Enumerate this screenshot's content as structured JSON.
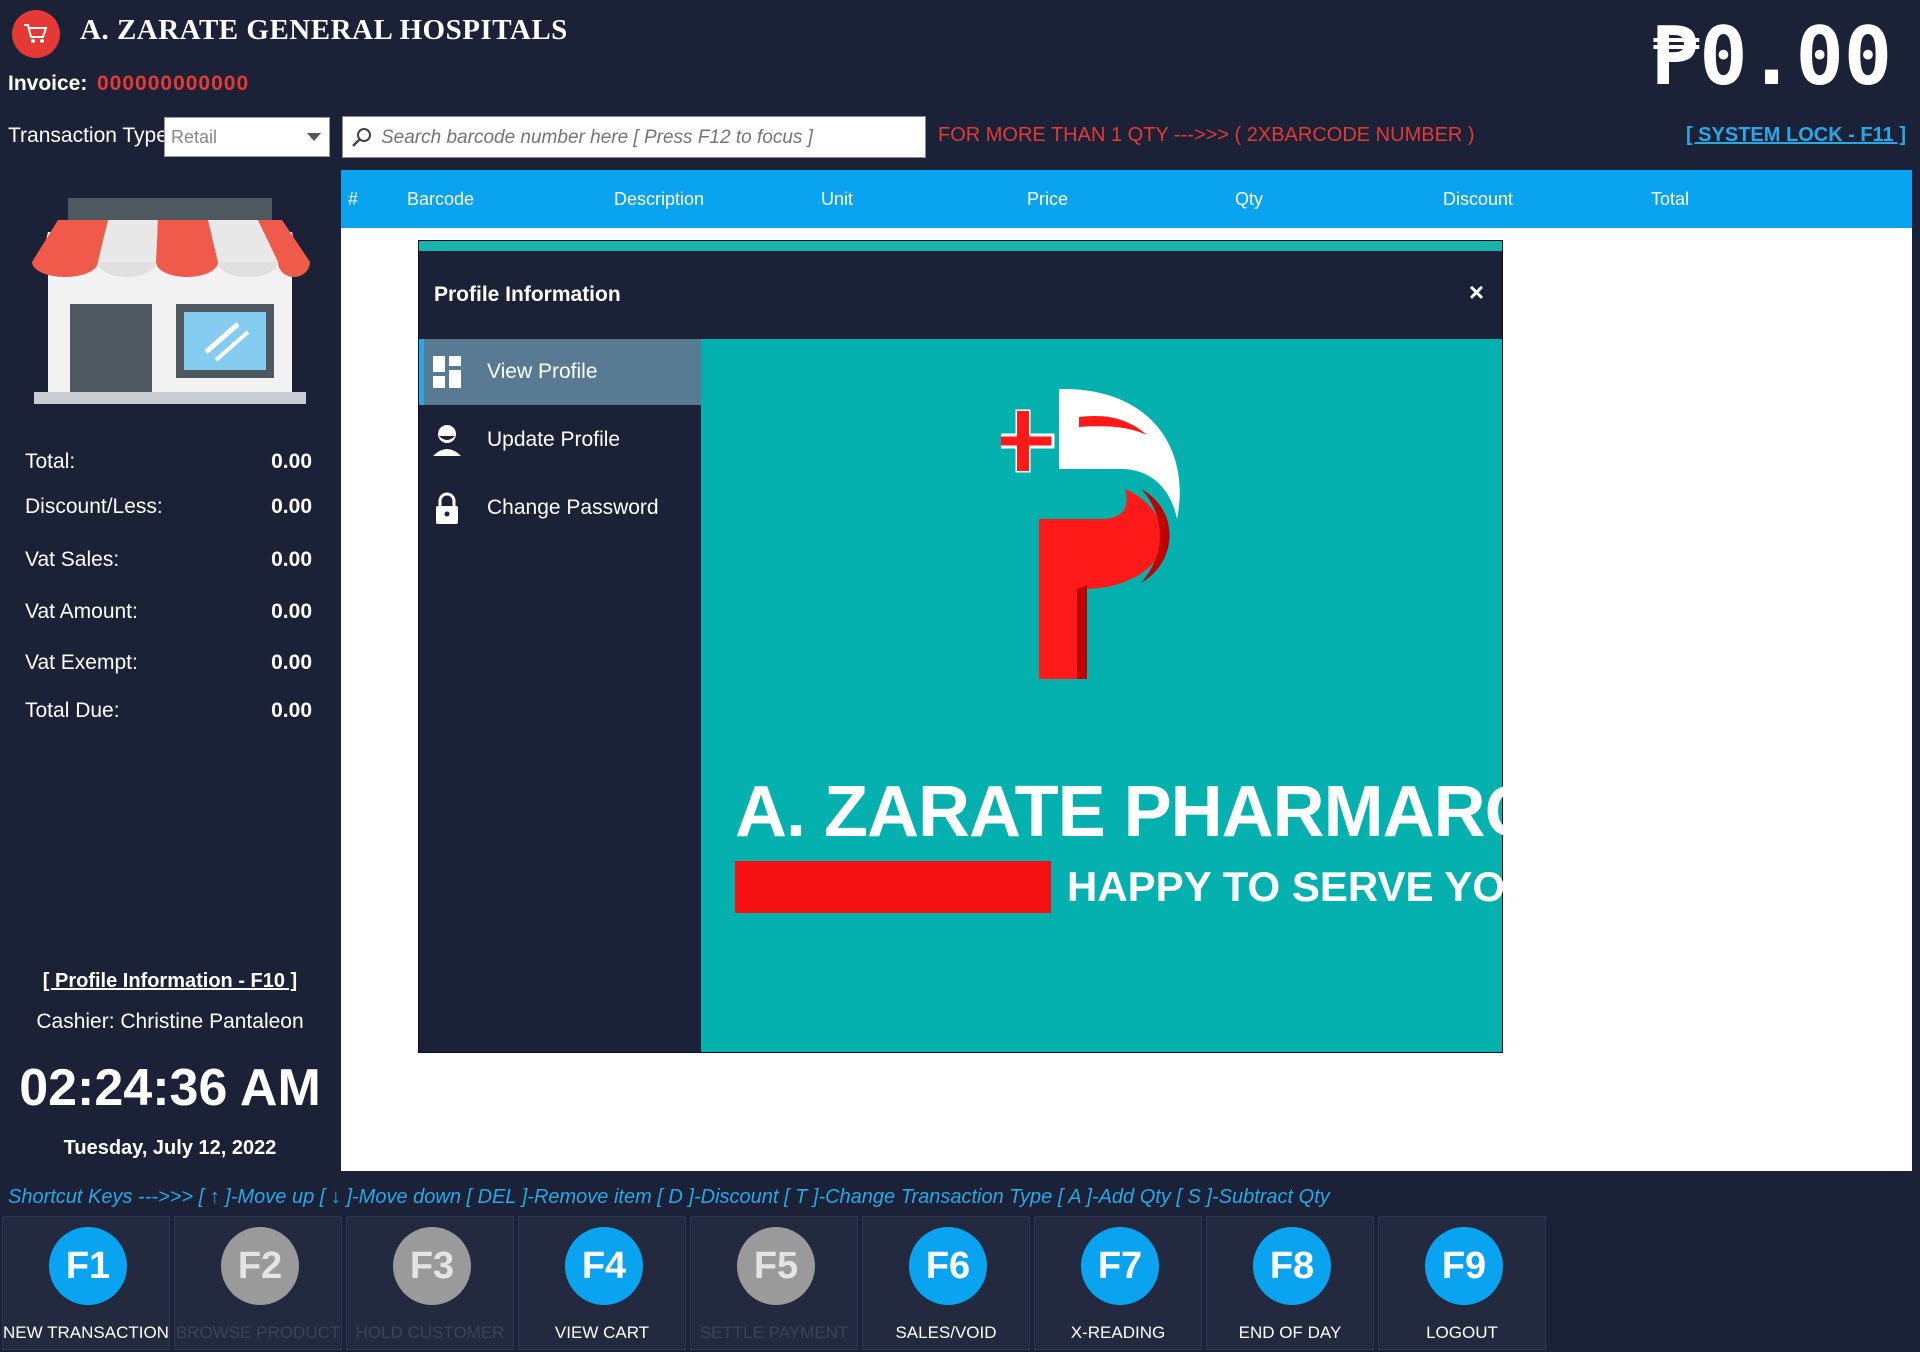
{
  "header": {
    "title": "A. ZARATE GENERAL HOSPITALS",
    "invoice_label": "Invoice:",
    "invoice_number": "000000000000",
    "total_amount": "₱0.00",
    "transaction_type_label": "Transaction Type:",
    "transaction_type_value": "Retail",
    "search_placeholder": "Search barcode number here [ Press F12 to focus ]",
    "qty_note": "FOR MORE THAN 1 QTY --->>> ( 2XBARCODE NUMBER )",
    "system_lock": "[ SYSTEM LOCK - F11 ]"
  },
  "summary": [
    {
      "label": "Total:",
      "value": "0.00"
    },
    {
      "label": "Discount/Less:",
      "value": "0.00"
    },
    {
      "label": "Vat Sales:",
      "value": "0.00"
    },
    {
      "label": "Vat Amount:",
      "value": "0.00"
    },
    {
      "label": "Vat Exempt:",
      "value": "0.00"
    },
    {
      "label": "Total Due:",
      "value": "0.00"
    }
  ],
  "sidebar": {
    "profile_link": "[ Profile Information - F10 ]",
    "cashier": "Cashier: Christine Pantaleon",
    "clock": "02:24:36 AM",
    "date": "Tuesday, July 12, 2022"
  },
  "table": {
    "columns": [
      "#",
      "Barcode",
      "Description",
      "Unit",
      "Price",
      "Qty",
      "Discount",
      "Total"
    ]
  },
  "modal": {
    "title": "Profile Information",
    "close": "×",
    "menu": [
      {
        "label": "View Profile",
        "icon": "dashboard-icon",
        "active": true
      },
      {
        "label": "Update Profile",
        "icon": "user-icon",
        "active": false
      },
      {
        "label": "Change Password",
        "icon": "lock-icon",
        "active": false
      }
    ],
    "brand_name": "A. ZARATE PHARMARCY",
    "tagline": "HAPPY TO SERVE YOU!"
  },
  "shortcuts": "Shortcut Keys --->>> [ ↑ ]-Move up [ ↓ ]-Move down  [ DEL ]-Remove item [ D ]-Discount [ T ]-Change Transaction Type [ A ]-Add Qty [ S ]-Subtract Qty",
  "function_keys": [
    {
      "key": "F1",
      "label": "NEW TRANSACTION",
      "enabled": true
    },
    {
      "key": "F2",
      "label": "BROWSE PRODUCT",
      "enabled": false
    },
    {
      "key": "F3",
      "label": "HOLD CUSTOMER",
      "enabled": false
    },
    {
      "key": "F4",
      "label": "VIEW CART",
      "enabled": true
    },
    {
      "key": "F5",
      "label": "SETTLE PAYMENT",
      "enabled": false
    },
    {
      "key": "F6",
      "label": "SALES/VOID",
      "enabled": true
    },
    {
      "key": "F7",
      "label": "X-READING",
      "enabled": true
    },
    {
      "key": "F8",
      "label": "END OF DAY",
      "enabled": true
    },
    {
      "key": "F9",
      "label": "LOGOUT",
      "enabled": true
    }
  ],
  "colors": {
    "background": "#1b2136",
    "accent_blue": "#0aa3ef",
    "accent_red": "#e53935",
    "teal": "#05b1ae"
  }
}
